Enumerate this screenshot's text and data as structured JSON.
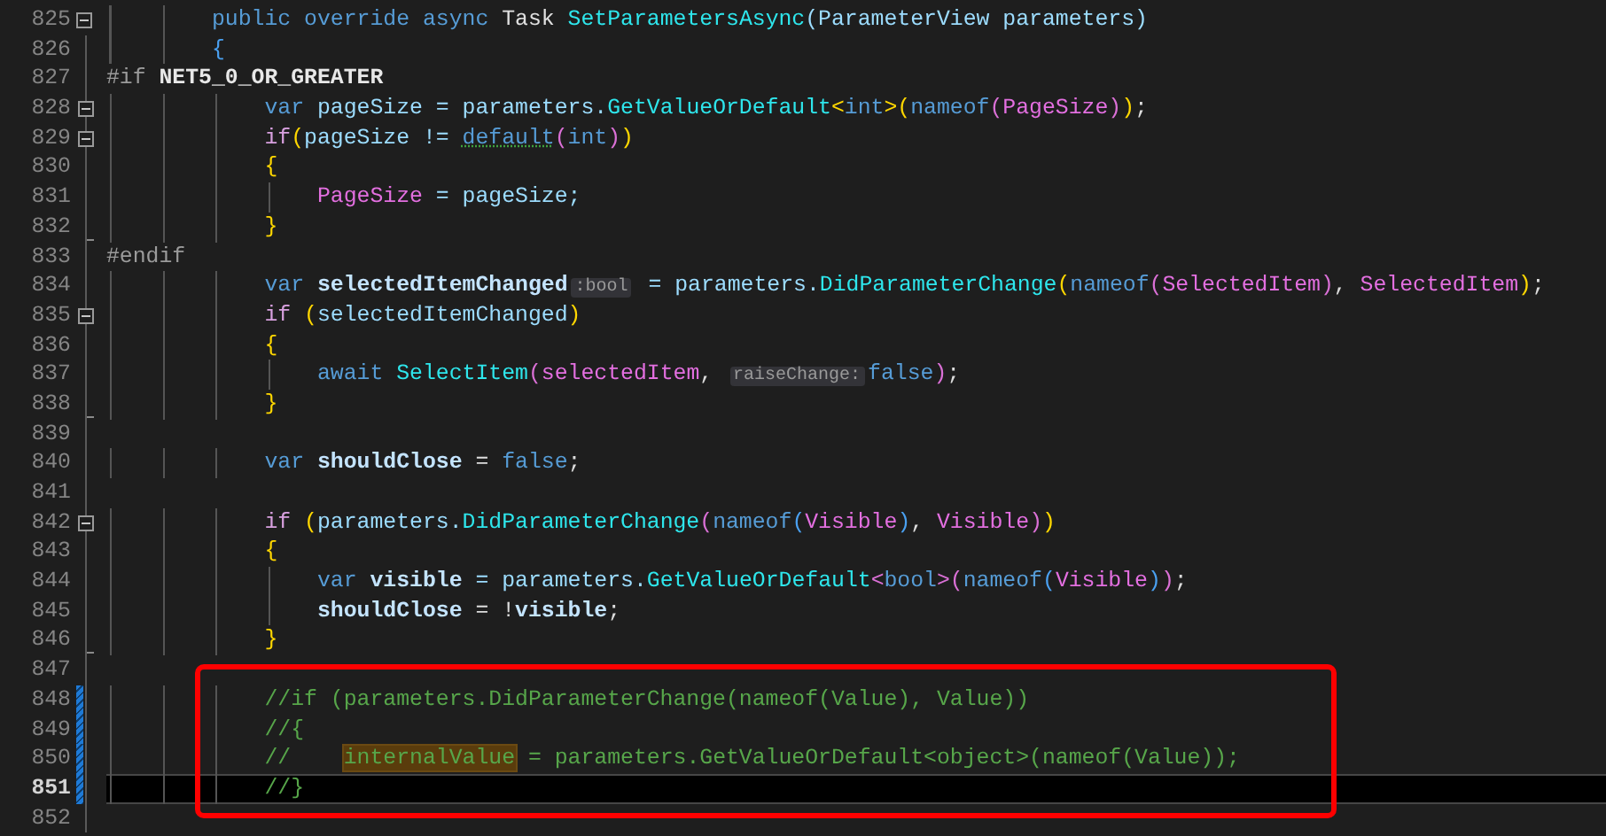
{
  "editor": {
    "lines": [
      {
        "number": "825",
        "collapsible": true,
        "block_end": false,
        "changed": false,
        "current": false,
        "boxed": false,
        "tokens": [
          {
            "text": "        public override async",
            "kind": "kw"
          },
          {
            "text": " Task ",
            "kind": "type"
          },
          {
            "text": "SetParametersAsync",
            "kind": "method"
          },
          {
            "text": "(ParameterView parameters)",
            "kind": "ident"
          }
        ]
      },
      {
        "number": "826",
        "collapsible": false,
        "block_end": false,
        "changed": false,
        "current": false,
        "boxed": false,
        "tokens": [
          {
            "text": "        {",
            "kind": "brace3"
          }
        ]
      },
      {
        "number": "827",
        "collapsible": false,
        "block_end": false,
        "changed": false,
        "current": false,
        "boxed": false,
        "tokens": [
          {
            "text": "#if",
            "kind": "pre"
          },
          {
            "text": " NET5_0_OR_GREATER",
            "kind": "symbol"
          }
        ]
      },
      {
        "number": "828",
        "collapsible": true,
        "block_end": false,
        "changed": false,
        "current": false,
        "boxed": false,
        "tokens": [
          {
            "text": "            var",
            "kind": "kw"
          },
          {
            "text": " pageSize = parameters.",
            "kind": "ident"
          },
          {
            "text": "GetValueOrDefault",
            "kind": "method"
          },
          {
            "text": "<",
            "kind": "brace1"
          },
          {
            "text": "int",
            "kind": "kw"
          },
          {
            "text": ">(",
            "kind": "brace1"
          },
          {
            "text": "nameof",
            "kind": "kw"
          },
          {
            "text": "(",
            "kind": "brace2"
          },
          {
            "text": "PageSize",
            "kind": "prop"
          },
          {
            "text": ")",
            "kind": "brace2"
          },
          {
            "text": ")",
            "kind": "brace1"
          },
          {
            "text": ";",
            "kind": "punct"
          }
        ]
      },
      {
        "number": "829",
        "collapsible": true,
        "block_end": false,
        "changed": false,
        "current": false,
        "boxed": false,
        "tokens": [
          {
            "text": "            if",
            "kind": "ctrl"
          },
          {
            "text": "(",
            "kind": "brace1"
          },
          {
            "text": "pageSize != ",
            "kind": "ident"
          },
          {
            "text": "default",
            "kind": "suggest"
          },
          {
            "text": "(",
            "kind": "brace2"
          },
          {
            "text": "int",
            "kind": "kw"
          },
          {
            "text": ")",
            "kind": "brace2"
          },
          {
            "text": ")",
            "kind": "brace1"
          }
        ]
      },
      {
        "number": "830",
        "collapsible": false,
        "block_end": false,
        "changed": false,
        "current": false,
        "boxed": false,
        "tokens": [
          {
            "text": "            {",
            "kind": "brace1"
          }
        ]
      },
      {
        "number": "831",
        "collapsible": false,
        "block_end": false,
        "changed": false,
        "current": false,
        "boxed": false,
        "tokens": [
          {
            "text": "                PageSize",
            "kind": "prop"
          },
          {
            "text": " = pageSize;",
            "kind": "ident"
          }
        ]
      },
      {
        "number": "832",
        "collapsible": false,
        "block_end": true,
        "changed": false,
        "current": false,
        "boxed": false,
        "tokens": [
          {
            "text": "            }",
            "kind": "brace1"
          }
        ]
      },
      {
        "number": "833",
        "collapsible": false,
        "block_end": false,
        "changed": false,
        "current": false,
        "boxed": false,
        "tokens": [
          {
            "text": "#endif",
            "kind": "pre"
          }
        ]
      },
      {
        "number": "834",
        "collapsible": false,
        "block_end": false,
        "changed": false,
        "current": false,
        "boxed": false,
        "tokens": [
          {
            "text": "            var",
            "kind": "kw"
          },
          {
            "text": " selectedItemChanged",
            "kind": "decl"
          },
          {
            "text": ":bool",
            "kind": "hint"
          },
          {
            "text": " = parameters.",
            "kind": "ident"
          },
          {
            "text": "DidParameterChange",
            "kind": "method"
          },
          {
            "text": "(",
            "kind": "brace1"
          },
          {
            "text": "nameof",
            "kind": "kw"
          },
          {
            "text": "(",
            "kind": "brace2"
          },
          {
            "text": "SelectedItem",
            "kind": "prop"
          },
          {
            "text": ")",
            "kind": "brace2"
          },
          {
            "text": ", ",
            "kind": "punct"
          },
          {
            "text": "SelectedItem",
            "kind": "prop"
          },
          {
            "text": ")",
            "kind": "brace1"
          },
          {
            "text": ";",
            "kind": "punct"
          }
        ]
      },
      {
        "number": "835",
        "collapsible": true,
        "block_end": false,
        "changed": false,
        "current": false,
        "boxed": false,
        "tokens": [
          {
            "text": "            if",
            "kind": "ctrl"
          },
          {
            "text": " (",
            "kind": "brace1"
          },
          {
            "text": "selectedItemChanged",
            "kind": "ident"
          },
          {
            "text": ")",
            "kind": "brace1"
          }
        ]
      },
      {
        "number": "836",
        "collapsible": false,
        "block_end": false,
        "changed": false,
        "current": false,
        "boxed": false,
        "tokens": [
          {
            "text": "            {",
            "kind": "brace1"
          }
        ]
      },
      {
        "number": "837",
        "collapsible": false,
        "block_end": false,
        "changed": false,
        "current": false,
        "boxed": false,
        "tokens": [
          {
            "text": "                await",
            "kind": "kw"
          },
          {
            "text": " SelectItem",
            "kind": "method"
          },
          {
            "text": "(",
            "kind": "brace2"
          },
          {
            "text": "selectedItem",
            "kind": "prop"
          },
          {
            "text": ", ",
            "kind": "punct"
          },
          {
            "text": "raiseChange:",
            "kind": "hint"
          },
          {
            "text": "false",
            "kind": "kw"
          },
          {
            "text": ")",
            "kind": "brace2"
          },
          {
            "text": ";",
            "kind": "punct"
          }
        ]
      },
      {
        "number": "838",
        "collapsible": false,
        "block_end": true,
        "changed": false,
        "current": false,
        "boxed": false,
        "tokens": [
          {
            "text": "            }",
            "kind": "brace1"
          }
        ]
      },
      {
        "number": "839",
        "collapsible": false,
        "block_end": false,
        "changed": false,
        "current": false,
        "boxed": false
      },
      {
        "number": "840",
        "collapsible": false,
        "block_end": false,
        "changed": false,
        "current": false,
        "boxed": false,
        "tokens": [
          {
            "text": "            var",
            "kind": "kw"
          },
          {
            "text": " shouldClose",
            "kind": "decl"
          },
          {
            "text": " = ",
            "kind": "punct"
          },
          {
            "text": "false",
            "kind": "kw"
          },
          {
            "text": ";",
            "kind": "punct"
          }
        ]
      },
      {
        "number": "841",
        "collapsible": false,
        "block_end": false,
        "changed": false,
        "current": false,
        "boxed": false
      },
      {
        "number": "842",
        "collapsible": true,
        "block_end": false,
        "changed": false,
        "current": false,
        "boxed": false,
        "tokens": [
          {
            "text": "            if",
            "kind": "ctrl"
          },
          {
            "text": " (",
            "kind": "brace1"
          },
          {
            "text": "parameters.",
            "kind": "ident"
          },
          {
            "text": "DidParameterChange",
            "kind": "method"
          },
          {
            "text": "(",
            "kind": "brace2"
          },
          {
            "text": "nameof",
            "kind": "kw"
          },
          {
            "text": "(",
            "kind": "brace3"
          },
          {
            "text": "Visible",
            "kind": "prop"
          },
          {
            "text": ")",
            "kind": "brace3"
          },
          {
            "text": ", ",
            "kind": "punct"
          },
          {
            "text": "Visible",
            "kind": "prop"
          },
          {
            "text": ")",
            "kind": "brace2"
          },
          {
            "text": ")",
            "kind": "brace1"
          }
        ]
      },
      {
        "number": "843",
        "collapsible": false,
        "block_end": false,
        "changed": false,
        "current": false,
        "boxed": false,
        "tokens": [
          {
            "text": "            {",
            "kind": "brace1"
          }
        ]
      },
      {
        "number": "844",
        "collapsible": false,
        "block_end": false,
        "changed": false,
        "current": false,
        "boxed": false,
        "tokens": [
          {
            "text": "                var",
            "kind": "kw"
          },
          {
            "text": " visible",
            "kind": "decl"
          },
          {
            "text": " = parameters.",
            "kind": "ident"
          },
          {
            "text": "GetValueOrDefault",
            "kind": "method"
          },
          {
            "text": "<",
            "kind": "brace2"
          },
          {
            "text": "bool",
            "kind": "kw"
          },
          {
            "text": ">(",
            "kind": "brace2"
          },
          {
            "text": "nameof",
            "kind": "kw"
          },
          {
            "text": "(",
            "kind": "brace3"
          },
          {
            "text": "Visible",
            "kind": "prop"
          },
          {
            "text": ")",
            "kind": "brace3"
          },
          {
            "text": ")",
            "kind": "brace2"
          },
          {
            "text": ";",
            "kind": "punct"
          }
        ]
      },
      {
        "number": "845",
        "collapsible": false,
        "block_end": false,
        "changed": false,
        "current": false,
        "boxed": false,
        "tokens": [
          {
            "text": "                shouldClose",
            "kind": "decl"
          },
          {
            "text": " = !",
            "kind": "punct"
          },
          {
            "text": "visible",
            "kind": "decl"
          },
          {
            "text": ";",
            "kind": "punct"
          }
        ]
      },
      {
        "number": "846",
        "collapsible": false,
        "block_end": true,
        "changed": false,
        "current": false,
        "boxed": false,
        "tokens": [
          {
            "text": "            }",
            "kind": "brace1"
          }
        ]
      },
      {
        "number": "847",
        "collapsible": false,
        "block_end": false,
        "changed": false,
        "current": false,
        "boxed": false
      },
      {
        "number": "848",
        "collapsible": false,
        "block_end": false,
        "changed": true,
        "current": false,
        "boxed": true,
        "tokens": [
          {
            "text": "            //if (parameters.DidParameterChange(nameof(Value), Value))",
            "kind": "comment"
          }
        ]
      },
      {
        "number": "849",
        "collapsible": false,
        "block_end": false,
        "changed": true,
        "current": false,
        "boxed": true,
        "tokens": [
          {
            "text": "            //{",
            "kind": "comment"
          }
        ]
      },
      {
        "number": "850",
        "collapsible": false,
        "block_end": false,
        "changed": true,
        "current": false,
        "boxed": true,
        "tokens": [
          {
            "text": "            //    ",
            "kind": "comment"
          },
          {
            "text": "internalValue",
            "kind": "marked"
          },
          {
            "text": " = parameters.GetValueOrDefault<object>(nameof(Value));",
            "kind": "comment"
          }
        ]
      },
      {
        "number": "851",
        "collapsible": false,
        "block_end": false,
        "changed": true,
        "current": true,
        "boxed": true,
        "tokens": [
          {
            "text": "            //}",
            "kind": "comment"
          }
        ]
      },
      {
        "number": "852",
        "collapsible": false,
        "block_end": false,
        "changed": false,
        "current": false,
        "boxed": false
      }
    ]
  }
}
